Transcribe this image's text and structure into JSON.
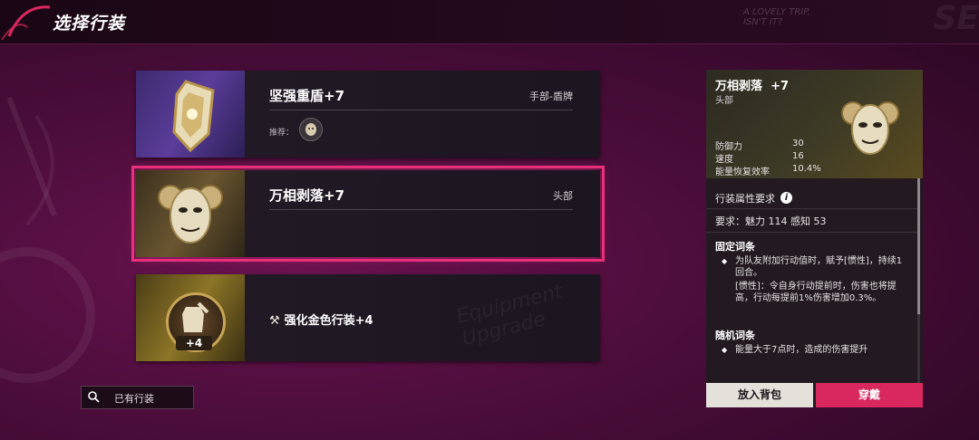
{
  "header": {
    "title": "选择行装",
    "scribble": "A LOVELY TRIP, ISN'T IT?"
  },
  "equipment_list": [
    {
      "name": "坚强重盾+7",
      "slot": "手部-盾牌",
      "recommend_label": "推荐：",
      "icon": "shield-icon"
    },
    {
      "name": "万相剥落+7",
      "slot": "头部",
      "icon": "mask-icon",
      "selected": true
    },
    {
      "upgrade_label": "强化金色行装+4",
      "badge_level": "+4",
      "icon": "hammer-icon",
      "watermark": "Equipment Upgrade"
    }
  ],
  "owned_filter": {
    "label": "已有行装",
    "icon": "search-icon"
  },
  "detail_panel": {
    "name": "万相剥落",
    "level": "+7",
    "slot": "头部",
    "stats": [
      {
        "label": "防御力",
        "value": "30"
      },
      {
        "label": "速度",
        "value": "16"
      },
      {
        "label": "能量恢复效率",
        "value": "10.4%"
      }
    ],
    "requirement_title": "行装属性要求",
    "requirement_value": "要求：魅力 114 感知 53",
    "fixed_title": "固定词条",
    "fixed_effect_1": "为队友附加行动值时，赋予[惯性]，持续1回合。",
    "fixed_effect_2": "[惯性]：令自身行动提前时，伤害也将提高，行动每提前1%伤害增加0.3%。",
    "random_title": "随机词条",
    "random_effect_1": "能量大于7点时，造成的伤害提升"
  },
  "actions": {
    "bag_label": "放入背包",
    "equip_label": "穿戴"
  },
  "colors": {
    "accent_pink": "#d8285e",
    "selected_outline": "#e8307a",
    "background": "#4a0d3a"
  }
}
